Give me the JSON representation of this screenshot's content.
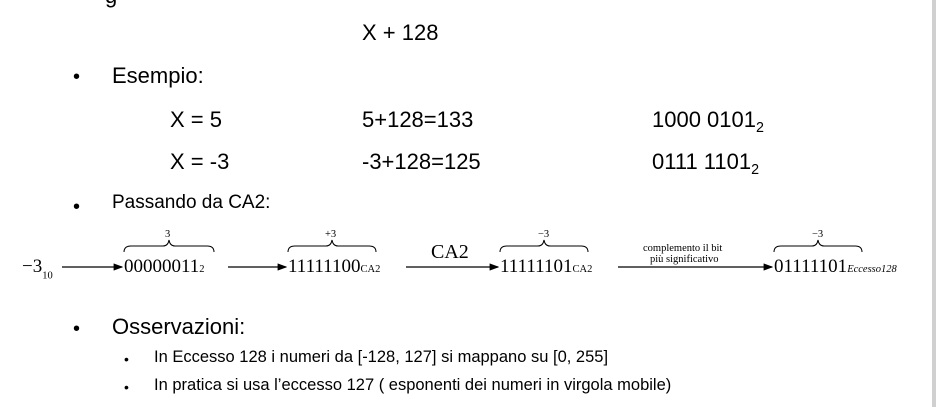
{
  "top_partial": "g",
  "formula": "X + 128",
  "bullets": {
    "symbol": "•",
    "esempio_label": "Esempio:",
    "passando_label": "Passando da CA2:",
    "osservazioni_label": "Osservazioni:"
  },
  "examples": [
    {
      "x": "X = 5",
      "sum": "5+128=133",
      "bin": "1000 0101",
      "base": "2"
    },
    {
      "x": "X = -3",
      "sum": "-3+128=125",
      "bin": "0111 1101",
      "base": "2"
    }
  ],
  "diagram": {
    "start_value": "−3",
    "start_base": "10",
    "step1_value": "00000011",
    "step1_sub": "2",
    "step1_brace": "3",
    "step2_value": "11111100",
    "step2_sub": "CA2",
    "step2_brace": "+3",
    "arrow_label": "CA2",
    "step3_value": "11111101",
    "step3_sub": "CA2",
    "step3_brace": "−3",
    "arrow2_label_top": "complemento il bit",
    "arrow2_label_bottom": "più significativo",
    "step4_value": "01111101",
    "step4_sub": "Eccesso128",
    "step4_brace": "−3"
  },
  "observations": [
    "In Eccesso 128 i numeri da [-128, 127] si mappano su [0, 255]",
    "In pratica si usa l’eccesso 127 ( esponenti dei numeri in virgola mobile)"
  ]
}
